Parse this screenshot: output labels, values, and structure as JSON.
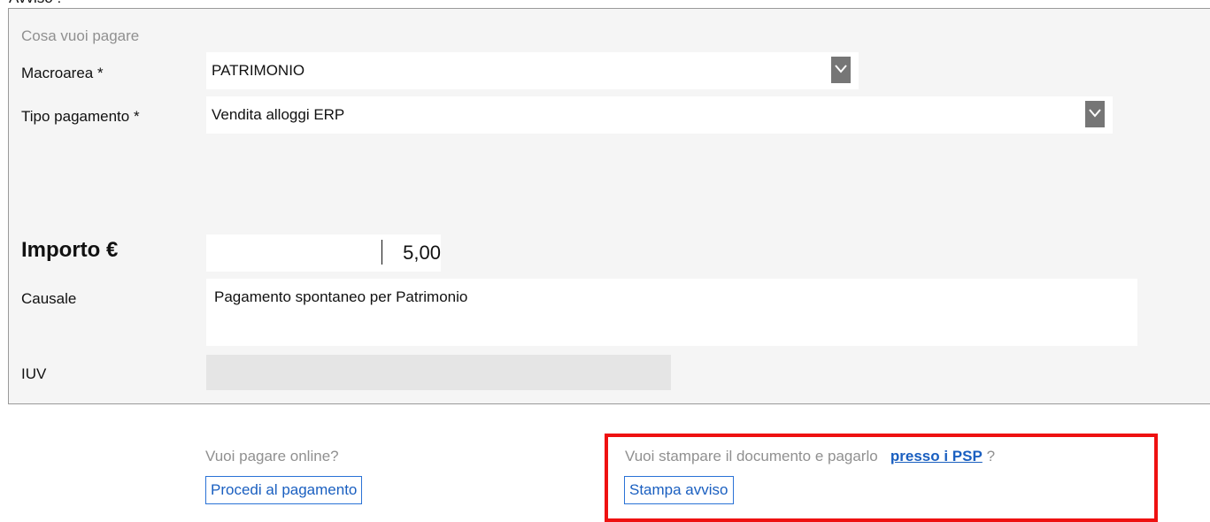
{
  "page": {
    "cut_heading": "Avviso :"
  },
  "form": {
    "section_title": "Cosa vuoi pagare",
    "macroarea": {
      "label": "Macroarea *",
      "value": "PATRIMONIO"
    },
    "tipo_pagamento": {
      "label": "Tipo pagamento *",
      "value": "Vendita alloggi ERP"
    },
    "importo": {
      "label": "Importo €",
      "value": "5,00"
    },
    "causale": {
      "label": "Causale",
      "value": "Pagamento spontaneo per Patrimonio"
    },
    "iuv": {
      "label": "IUV",
      "value": ""
    }
  },
  "actions": {
    "online_question": "Vuoi pagare online?",
    "pay_button": "Procedi al pagamento",
    "print_question": "Vuoi stampare il documento e pagarlo",
    "psp_link": "presso i PSP",
    "question_mark": "?",
    "print_button": "Stampa avviso"
  },
  "colors": {
    "highlight": "#ee1111",
    "link": "#1a5fc0",
    "panel_background": "#f5f5f5"
  },
  "icons": {
    "dropdown": "chevron-down-icon"
  }
}
